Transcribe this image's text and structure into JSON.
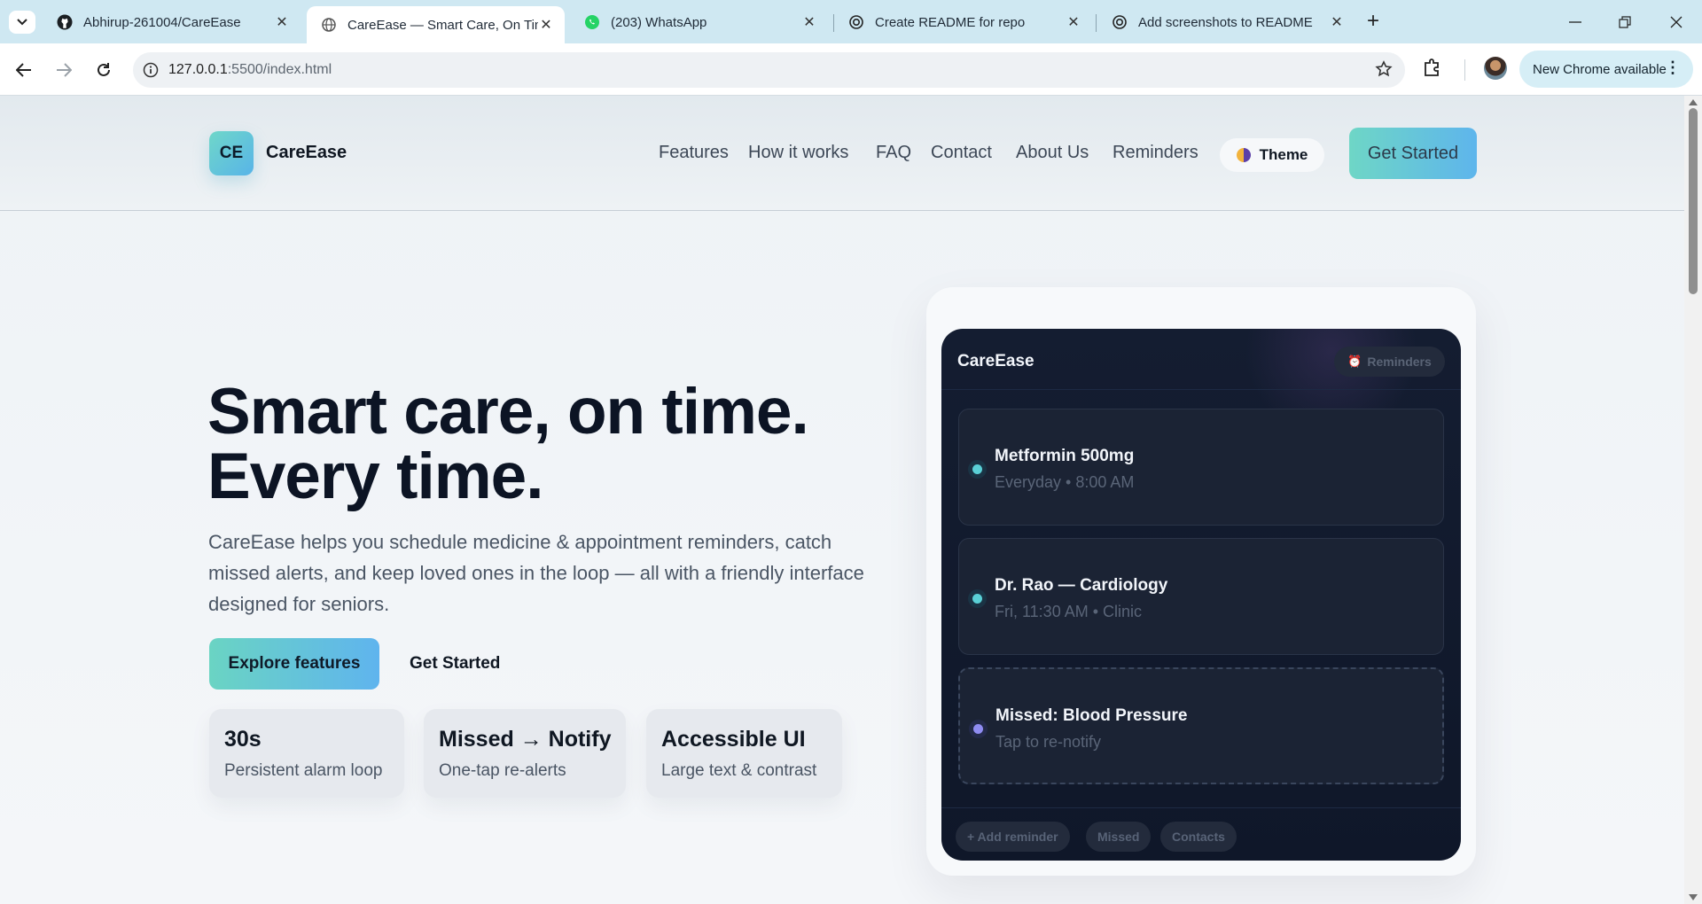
{
  "browser": {
    "tabs": [
      {
        "title": "Abhirup-261004/CareEase",
        "icon": "github-icon",
        "active": false
      },
      {
        "title": "CareEase — Smart Care, On Tim",
        "icon": "globe-icon",
        "active": true
      },
      {
        "title": "(203) WhatsApp",
        "icon": "whatsapp-icon",
        "active": false
      },
      {
        "title": "Create README for repo",
        "icon": "chatgpt-icon",
        "active": false
      },
      {
        "title": "Add screenshots to README",
        "icon": "chatgpt-icon",
        "active": false
      }
    ],
    "url_host": "127.0.0.1",
    "url_rest": ":5500/index.html",
    "update_label": "New Chrome available"
  },
  "site": {
    "logo_initials": "CE",
    "brand": "CareEase",
    "nav": [
      "Features",
      "How it works",
      "FAQ",
      "Contact",
      "About Us",
      "Reminders"
    ],
    "theme_label": "Theme",
    "cta_label": "Get Started"
  },
  "hero": {
    "title_line1": "Smart care, on time.",
    "title_line2": "Every time.",
    "description": "CareEase helps you schedule medicine & appointment reminders, catch missed alerts, and keep loved ones in the loop — all with a friendly interface designed for seniors.",
    "explore_label": "Explore features",
    "getstarted_label": "Get Started",
    "stats": [
      {
        "big": "30s",
        "small": "Persistent alarm loop"
      },
      {
        "big": "Missed → Notify",
        "small": "One-tap re-alerts"
      },
      {
        "big": "Accessible UI",
        "small": "Large text & contrast"
      }
    ]
  },
  "phone": {
    "title": "CareEase",
    "badge": "Reminders",
    "badge_icon": "alarm-clock-icon",
    "cards": [
      {
        "title": "Metformin 500mg",
        "subtitle": "Everyday • 8:00 AM"
      },
      {
        "title": "Dr. Rao — Cardiology",
        "subtitle": "Fri, 11:30 AM • Clinic"
      },
      {
        "title": "Missed: Blood Pressure",
        "subtitle": "Tap to re-notify"
      }
    ],
    "chips": [
      "+ Add reminder",
      "Missed",
      "Contacts"
    ]
  },
  "colors": {
    "accent_start": "#6ed6c6",
    "accent_end": "#5eb5ec",
    "phone_bg": "#141d31",
    "dot_teal": "#5ad0d6",
    "dot_violet": "#8f8cf2"
  }
}
